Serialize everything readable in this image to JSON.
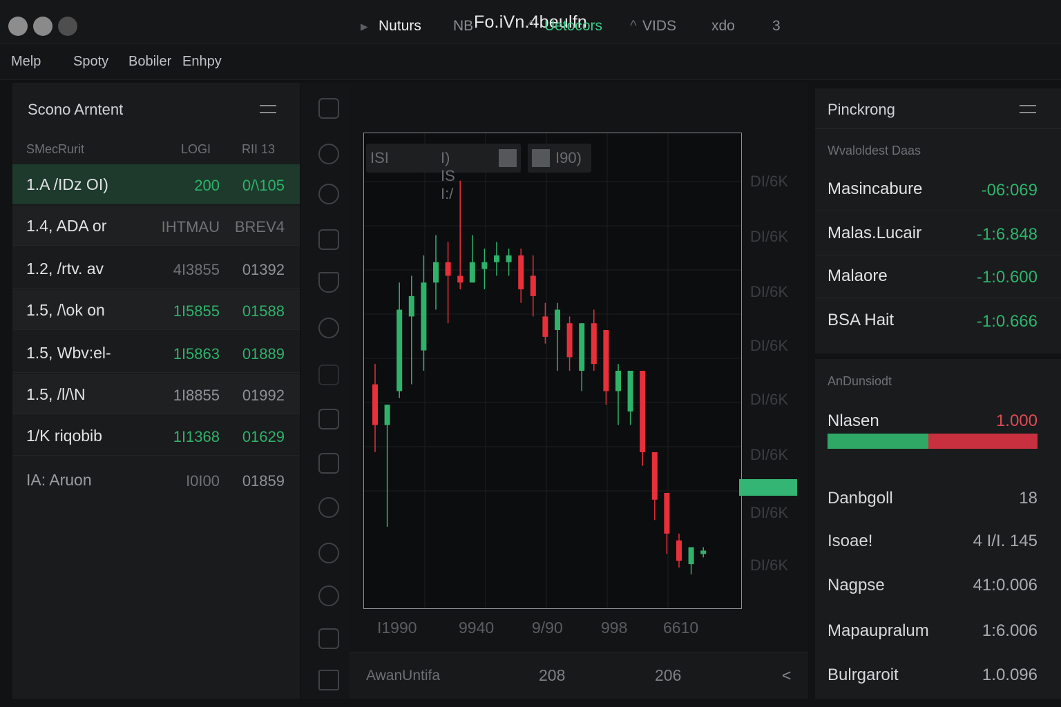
{
  "window": {
    "title": "Fo.iVn.4beulfn"
  },
  "menu": [
    "Melp",
    "Spoty",
    "Bobiler",
    "Enhpy"
  ],
  "watchlist": {
    "title": "Scono Arntent",
    "headers": [
      "SMecRurit",
      "LOGI",
      "RII 13"
    ],
    "rows": [
      {
        "symbol": "1.A /IDz OI)",
        "v1": "200",
        "v2": "0/\\105"
      },
      {
        "symbol": "1.4, ADA or",
        "v1": "IHTMAU",
        "v2": "BREV4"
      },
      {
        "symbol": "1.2, /rtv. av",
        "v1": "4I3855",
        "v2": "01392"
      },
      {
        "symbol": "1.5, /\\ok on",
        "v1": "1I5855",
        "v2": "01588"
      },
      {
        "symbol": "1.5, Wbv:el-",
        "v1": "1I5863",
        "v2": "01889"
      },
      {
        "symbol": "1.5, /l/\\N",
        "v1": "1I8855",
        "v2": "01992"
      },
      {
        "symbol": "1/K riqobib",
        "v1": "1I1368",
        "v2": "01629"
      },
      {
        "symbol": "IA: Aruon",
        "v1": "I0I00",
        "v2": "01859"
      }
    ]
  },
  "chart_tabs": [
    "Nuturs",
    "NB",
    "Uetocors",
    "VIDS",
    "xdo",
    "3"
  ],
  "plot_toolbar": [
    "ISI",
    "I) IS I:/"
  ],
  "plot_toolbar_value": "I90)",
  "y_axis": [
    "DI/6K",
    "DI/6K",
    "DI/6K",
    "DI/6K",
    "DI/6K",
    "DI/6K",
    "DI/6K",
    "DI/6K"
  ],
  "x_axis": [
    "I1990",
    "9940",
    "9/90",
    "998",
    "6610"
  ],
  "chart_footer": {
    "label": "AwanUntifa",
    "v1": "208",
    "v2": "206",
    "arrow": "<"
  },
  "chart_data": {
    "type": "candlestick",
    "candles": [
      {
        "o": 58.0,
        "h": 61.0,
        "l": 48.0,
        "c": 52.0
      },
      {
        "o": 52.0,
        "h": 53.0,
        "l": 37.0,
        "c": 55.0
      },
      {
        "o": 57.0,
        "h": 73.0,
        "l": 56.0,
        "c": 69.0
      },
      {
        "o": 68.0,
        "h": 74.0,
        "l": 58.0,
        "c": 71.0
      },
      {
        "o": 63.0,
        "h": 77.0,
        "l": 60.0,
        "c": 73.0
      },
      {
        "o": 73.0,
        "h": 80.0,
        "l": 69.0,
        "c": 76.0
      },
      {
        "o": 76.0,
        "h": 79.0,
        "l": 67.0,
        "c": 74.0
      },
      {
        "o": 74.0,
        "h": 88.0,
        "l": 72.0,
        "c": 73.0
      },
      {
        "o": 73.0,
        "h": 80.0,
        "l": 73.0,
        "c": 76.0
      },
      {
        "o": 75.0,
        "h": 78.0,
        "l": 72.0,
        "c": 76.0
      },
      {
        "o": 76.0,
        "h": 79.0,
        "l": 74.0,
        "c": 77.0
      },
      {
        "o": 76.0,
        "h": 78.0,
        "l": 74.0,
        "c": 77.0
      },
      {
        "o": 77.0,
        "h": 78.0,
        "l": 70.0,
        "c": 72.0
      },
      {
        "o": 74.0,
        "h": 77.0,
        "l": 68.0,
        "c": 71.0
      },
      {
        "o": 68.0,
        "h": 70.0,
        "l": 64.0,
        "c": 65.0
      },
      {
        "o": 66.0,
        "h": 70.0,
        "l": 60.0,
        "c": 69.0
      },
      {
        "o": 67.0,
        "h": 68.0,
        "l": 60.0,
        "c": 62.0
      },
      {
        "o": 60.0,
        "h": 67.0,
        "l": 57.0,
        "c": 67.0
      },
      {
        "o": 67.0,
        "h": 69.0,
        "l": 60.0,
        "c": 61.0
      },
      {
        "o": 66.0,
        "h": 66.0,
        "l": 55.0,
        "c": 57.0
      },
      {
        "o": 57.0,
        "h": 61.0,
        "l": 52.0,
        "c": 60.0
      },
      {
        "o": 54.0,
        "h": 58.0,
        "l": 52.0,
        "c": 60.0
      },
      {
        "o": 60.0,
        "h": 60.0,
        "l": 46.0,
        "c": 48.0
      },
      {
        "o": 48.0,
        "h": 48.0,
        "l": 38.0,
        "c": 41.0
      },
      {
        "o": 42.0,
        "h": 42.0,
        "l": 33.0,
        "c": 36.0
      },
      {
        "o": 35.0,
        "h": 36.0,
        "l": 31.0,
        "c": 32.0
      },
      {
        "o": 31.5,
        "h": 34.0,
        "l": 30.0,
        "c": 34.0
      },
      {
        "o": 33.0,
        "h": 34.0,
        "l": 32.5,
        "c": 33.5
      }
    ],
    "ylim": [
      25,
      95
    ],
    "up_color": "#2fb36b",
    "down_color": "#e8303a",
    "grid": true
  },
  "right_panel": {
    "title": "Pinckrong",
    "subtitle": "Wvaloldest Daas",
    "rows": [
      {
        "label": "Masincabure",
        "value": "-06:069"
      },
      {
        "label": "Malas.Lucair",
        "value": "-1:6.848"
      },
      {
        "label": "Malaore",
        "value": "-1:0.600"
      },
      {
        "label": "BSA Hait",
        "value": "-1:0.666"
      }
    ],
    "section2_title": "AnDunsiodt",
    "balance": {
      "label": "Nlasen",
      "value": "1.000",
      "ratio": 0.48
    },
    "rows2": [
      {
        "label": "Danbgoll",
        "value": "18"
      },
      {
        "label": "Isoae!",
        "value": "4 I/I. 145"
      },
      {
        "label": "Nagpse",
        "value": "41:0.006"
      },
      {
        "label": "Mapaupralum",
        "value": "1:6.006"
      },
      {
        "label": "Bulrgaroit",
        "value": "1.0.096"
      }
    ]
  },
  "colors": {
    "accent_green": "#2fb36b",
    "accent_red": "#e8303a",
    "background": "#111214"
  }
}
